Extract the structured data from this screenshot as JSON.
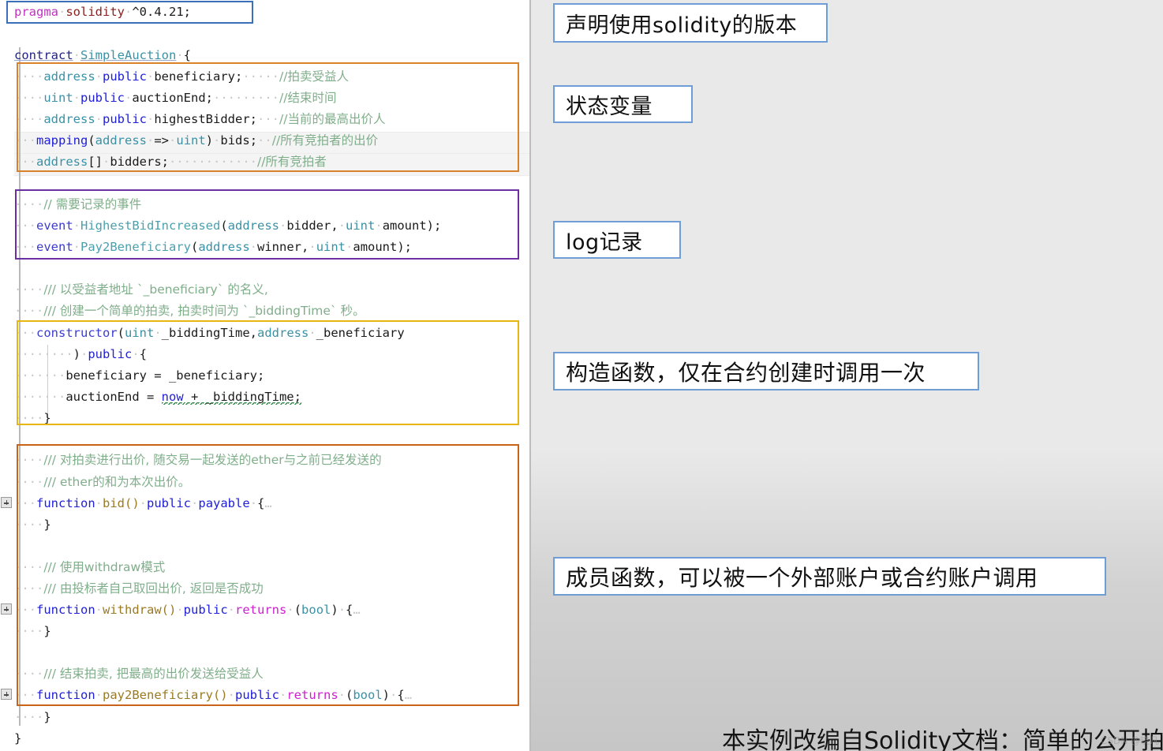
{
  "editor": {
    "language": "solidity",
    "lines": [
      {
        "id": "l1",
        "text": "pragma solidity ^0.4.21;"
      },
      {
        "id": "l2",
        "text": ""
      },
      {
        "id": "l3",
        "text": "contract SimpleAuction {"
      },
      {
        "id": "l4",
        "text": "    address public beneficiary;      //拍卖受益人"
      },
      {
        "id": "l5",
        "text": "    uint public auctionEnd;          //结束时间"
      },
      {
        "id": "l6",
        "text": "    address public highestBidder;    //当前的最高出价人"
      },
      {
        "id": "l7",
        "text": "    mapping(address => uint) bids;   //所有竞拍者的出价"
      },
      {
        "id": "l8",
        "text": "    address[] bidders;               //所有竞拍者"
      },
      {
        "id": "l9",
        "text": ""
      },
      {
        "id": "l10",
        "text": "    // 需要记录的事件"
      },
      {
        "id": "l11",
        "text": "    event HighestBidIncreased(address bidder, uint amount);"
      },
      {
        "id": "l12",
        "text": "    event Pay2Beneficiary(address winner, uint amount);"
      },
      {
        "id": "l13",
        "text": ""
      },
      {
        "id": "l14",
        "text": "    /// 以受益者地址 `_beneficiary` 的名义,"
      },
      {
        "id": "l15",
        "text": "    /// 创建一个简单的拍卖, 拍卖时间为 `_biddingTime` 秒。"
      },
      {
        "id": "l16",
        "text": "    constructor(uint _biddingTime,address _beneficiary"
      },
      {
        "id": "l17",
        "text": "        ) public {"
      },
      {
        "id": "l18",
        "text": "        beneficiary = _beneficiary;"
      },
      {
        "id": "l19",
        "text": "        auctionEnd = now + _biddingTime;"
      },
      {
        "id": "l20",
        "text": "    }"
      },
      {
        "id": "l21",
        "text": ""
      },
      {
        "id": "l22",
        "text": "    /// 对拍卖进行出价, 随交易一起发送的ether与之前已经发送的"
      },
      {
        "id": "l23",
        "text": "    /// ether的和为本次出价。"
      },
      {
        "id": "l24",
        "text": "    function bid() public payable {…"
      },
      {
        "id": "l25",
        "text": "    }"
      },
      {
        "id": "l26",
        "text": ""
      },
      {
        "id": "l27",
        "text": "    /// 使用withdraw模式"
      },
      {
        "id": "l28",
        "text": "    /// 由投标者自己取回出价, 返回是否成功"
      },
      {
        "id": "l29",
        "text": "    function withdraw() public returns (bool) {…"
      },
      {
        "id": "l30",
        "text": "    }"
      },
      {
        "id": "l31",
        "text": ""
      },
      {
        "id": "l32",
        "text": "    /// 结束拍卖, 把最高的出价发送给受益人"
      },
      {
        "id": "l33",
        "text": "    function pay2Beneficiary() public returns (bool) {…"
      },
      {
        "id": "l34",
        "text": "    }"
      },
      {
        "id": "l35",
        "text": "}"
      }
    ],
    "tokens": {
      "pragma": "pragma",
      "solidity": "solidity",
      "version": "^0.4.21;",
      "contract_kw": "contract",
      "contract_name": "SimpleAuction",
      "brace_open": "{",
      "brace_close": "}",
      "kw_address": "address",
      "kw_uint": "uint",
      "kw_public": "public",
      "kw_payable": "payable",
      "kw_mapping": "mapping",
      "kw_event": "event",
      "kw_constructor": "constructor",
      "kw_function": "function",
      "kw_returns": "returns",
      "kw_bool": "bool",
      "kw_now": "now",
      "var_beneficiary": "beneficiary;",
      "var_auctionEnd": "auctionEnd;",
      "var_highestBidder": "highestBidder;",
      "var_bids": "bids;",
      "var_bidders": "bidders;",
      "fn_bid": "bid()",
      "fn_withdraw": "withdraw()",
      "fn_pay2Beneficiary": "pay2Beneficiary()",
      "ellipsis": "…"
    },
    "comments": {
      "c_beneficiary": "//拍卖受益人",
      "c_auctionEnd": "//结束时间",
      "c_highestBidder": "//当前的最高出价人",
      "c_bids": "//所有竞拍者的出价",
      "c_bidders": "//所有竞拍者",
      "c_events": "// 需要记录的事件",
      "c_ctor1": "/// 以受益者地址 `_beneficiary` 的名义,",
      "c_ctor2": "/// 创建一个简单的拍卖, 拍卖时间为 `_biddingTime` 秒。",
      "c_bid1": "/// 对拍卖进行出价, 随交易一起发送的ether与之前已经发送的",
      "c_bid2": "/// ether的和为本次出价。",
      "c_withdraw1": "/// 使用withdraw模式",
      "c_withdraw2": "/// 由投标者自己取回出价, 返回是否成功",
      "c_pay1": "/// 结束拍卖, 把最高的出价发送给受益人"
    },
    "fold_markers": [
      {
        "name": "fold-bid",
        "label": "+"
      },
      {
        "name": "fold-withdraw",
        "label": "+"
      },
      {
        "name": "fold-pay2beneficiary",
        "label": "+"
      }
    ]
  },
  "annotations": [
    {
      "id": "a1",
      "name": "annotation-version",
      "text": "声明使用solidity的版本"
    },
    {
      "id": "a2",
      "name": "annotation-state-vars",
      "text": "状态变量"
    },
    {
      "id": "a3",
      "name": "annotation-log",
      "text": "log记录"
    },
    {
      "id": "a4",
      "name": "annotation-constructor",
      "text": "构造函数，仅在合约创建时调用一次"
    },
    {
      "id": "a5",
      "name": "annotation-member-funcs",
      "text": "成员函数，可以被一个外部账户或合约账户调用"
    }
  ],
  "caption": {
    "text": "本实例改编自Solidity文档：简单的公开拍卖",
    "watermark": "CSDN @晓凡"
  },
  "colors": {
    "panel_background": "#e9e9e9",
    "editor_background": "#ffffff",
    "callout_border": "#6f9ed6",
    "box_state_vars": "#d9822b",
    "box_events": "#6a2fa0",
    "box_constructor": "#e8b611",
    "box_functions": "#c8631a",
    "keyword": "#2020d8",
    "type": "#3a91a6",
    "comment": "#6a9955",
    "function_name": "#9a7a22",
    "returns": "#cc22cc",
    "pragma": "#c330c3"
  }
}
